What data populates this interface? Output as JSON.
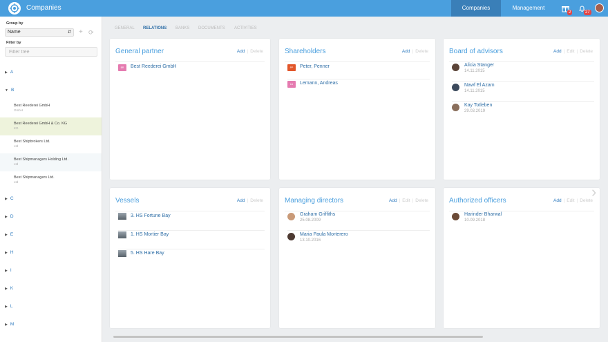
{
  "app": {
    "title": "Companies"
  },
  "topnav": {
    "tabs": [
      "Companies",
      "Management"
    ],
    "gift_badge": "2",
    "notif_badge": "27"
  },
  "sidebar": {
    "group_by_label": "Group by",
    "group_by_value": "Name",
    "filter_label": "Filter by",
    "filter_placeholder": "Filter tree",
    "letters": [
      "A",
      "B",
      "C",
      "D",
      "E",
      "H",
      "I",
      "K",
      "L",
      "M"
    ],
    "companies": [
      {
        "name": "Best Reederei GmbH",
        "sub": "GmbH"
      },
      {
        "name": "Best Reederei GmbH & Co. KG",
        "sub": "KG"
      },
      {
        "name": "Best Shipbrokers Ltd.",
        "sub": "Ltd"
      },
      {
        "name": "Best Shipmanagers Holding Ltd.",
        "sub": "Ltd"
      },
      {
        "name": "Best Shipmanagers Ltd.",
        "sub": "Ltd"
      }
    ]
  },
  "content_tabs": [
    "GENERAL",
    "RELATIONS",
    "BANKS",
    "DOCUMENTS",
    "ACTIVITIES"
  ],
  "actions": {
    "add": "Add",
    "edit": "Edit",
    "delete": "Delete"
  },
  "cards": {
    "general_partner": {
      "title": "General partner",
      "items": [
        {
          "tag": "BR",
          "name": "Best Reederei GmbH",
          "color": "#e57bb0"
        }
      ]
    },
    "shareholders": {
      "title": "Shareholders",
      "items": [
        {
          "tag": "PP",
          "name": "Peter, Penner",
          "color": "#e2562a"
        },
        {
          "tag": "LA",
          "name": "Lemann, Andreas",
          "color": "#e57bb0"
        }
      ]
    },
    "board": {
      "title": "Board of advisors",
      "items": [
        {
          "name": "Alicia Stanger",
          "date": "14.11.2015"
        },
        {
          "name": "Nawf El Azam",
          "date": "14.11.2015"
        },
        {
          "name": "Kay Totleben",
          "date": "29.03.2019"
        }
      ]
    },
    "vessels": {
      "title": "Vessels",
      "items": [
        {
          "name": "3. HS Fortune Bay"
        },
        {
          "name": "1. HS Mortier Bay"
        },
        {
          "name": "5. HS Hare Bay"
        }
      ]
    },
    "managing": {
      "title": "Managing directors",
      "items": [
        {
          "name": "Graham Griffiths",
          "date": "25.08.2009"
        },
        {
          "name": "Maria Paula Morterero",
          "date": "13.10.2016"
        }
      ]
    },
    "officers": {
      "title": "Authorized officers",
      "items": [
        {
          "name": "Harinder Bharwal",
          "date": "10.09.2018"
        }
      ]
    }
  },
  "colors": {
    "accent": "#4a9fde",
    "topbar_active": "#3a7fb8",
    "selected_row": "#eef3dc"
  }
}
